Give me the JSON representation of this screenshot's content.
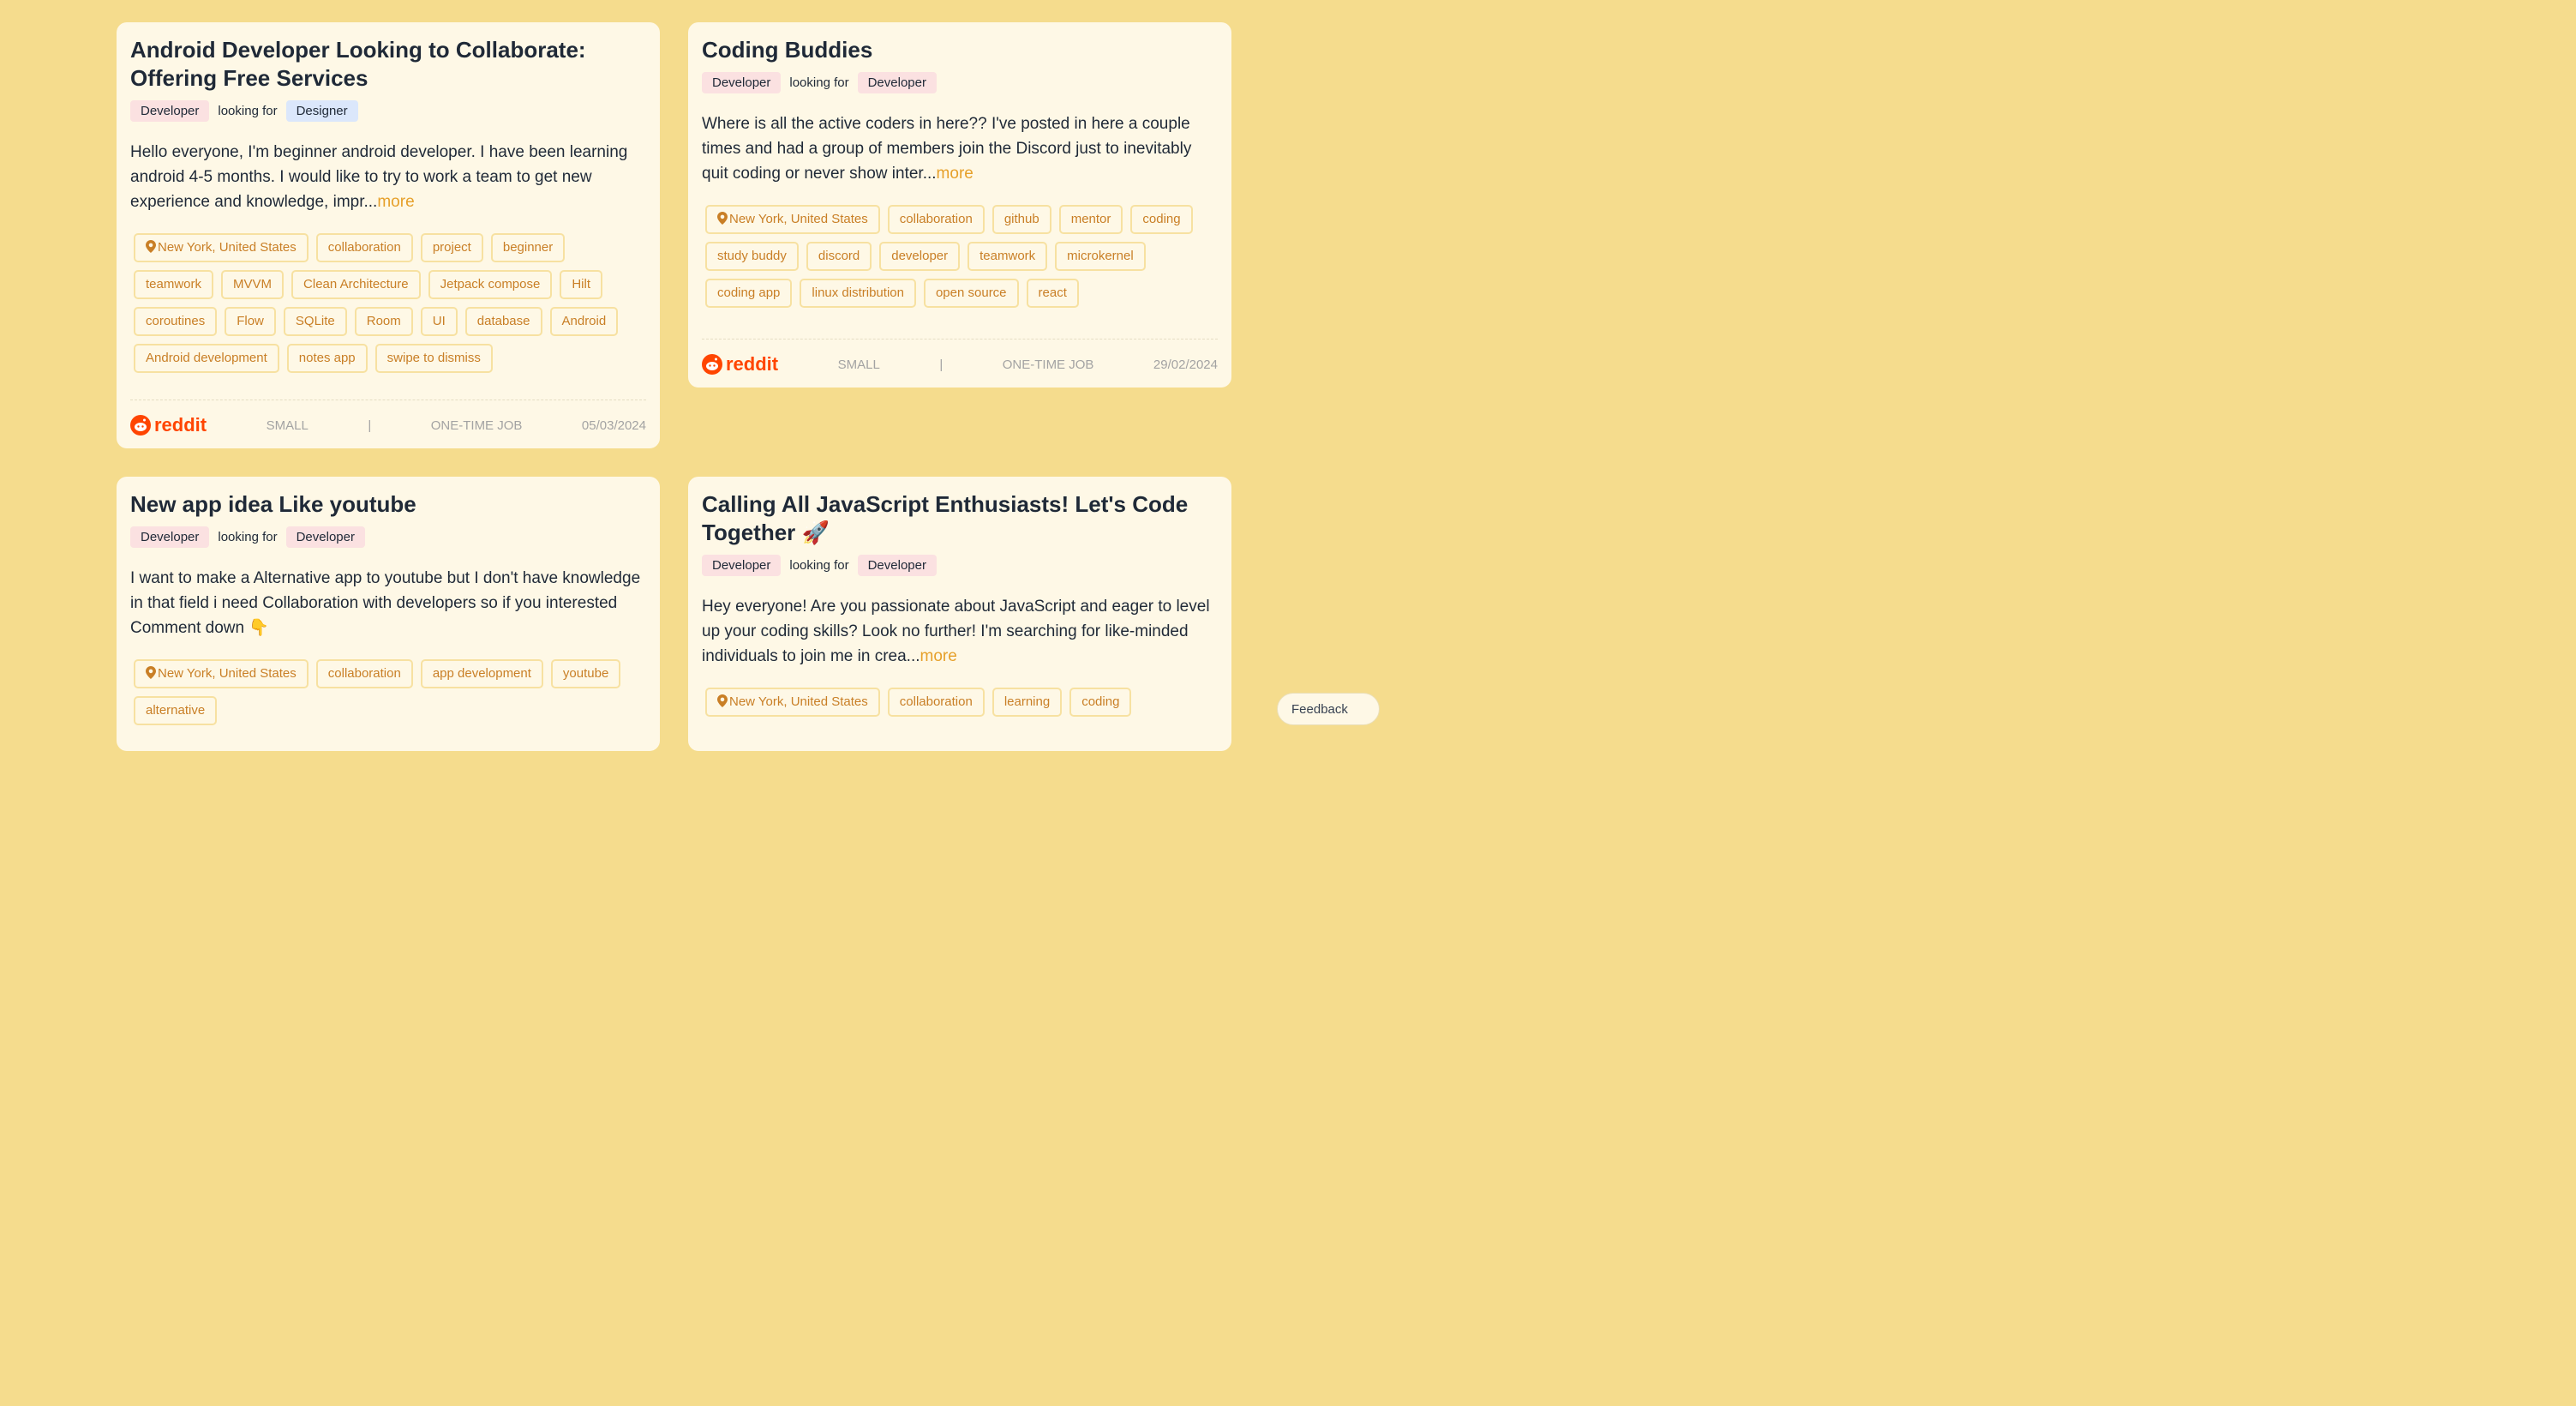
{
  "cards": [
    {
      "title": "Android Developer Looking to Collaborate: Offering Free Services",
      "role_from": "Developer",
      "looking_for": "looking for",
      "role_to": "Designer",
      "description": "Hello everyone, I'm beginner android developer. I have been learning android 4-5 months. I would like to try to work a team to get new experience and knowledge, impr...",
      "more": "more",
      "tags": [
        "New York, United States",
        "collaboration",
        "project",
        "beginner",
        "teamwork",
        "MVVM",
        "Clean Architecture",
        "Jetpack compose",
        "Hilt",
        "coroutines",
        "Flow",
        "SQLite",
        "Room",
        "UI",
        "database",
        "Android",
        "Android development",
        "notes app",
        "swipe to dismiss"
      ],
      "footer": {
        "source": "reddit",
        "size": "SMALL",
        "sep": "|",
        "type": "ONE-TIME JOB",
        "date": "05/03/2024"
      }
    },
    {
      "title": "Coding Buddies",
      "role_from": "Developer",
      "looking_for": "looking for",
      "role_to": "Developer",
      "description": "Where is all the active coders in here?? I've posted in here a couple times and had a group of members join the Discord just to inevitably quit coding or never show inter...",
      "more": "more",
      "tags": [
        "New York, United States",
        "collaboration",
        "github",
        "mentor",
        "coding",
        "study buddy",
        "discord",
        "developer",
        "teamwork",
        "microkernel",
        "coding app",
        "linux distribution",
        "open source",
        "react"
      ],
      "footer": {
        "source": "reddit",
        "size": "SMALL",
        "sep": "|",
        "type": "ONE-TIME JOB",
        "date": "29/02/2024"
      }
    },
    {
      "title": "New app idea Like youtube",
      "role_from": "Developer",
      "looking_for": "looking for",
      "role_to": "Developer",
      "description": "I want to make a Alternative app to youtube but I don't have knowledge in that field i need Collaboration with developers so if you interested Comment down 👇",
      "more": "",
      "tags": [
        "New York, United States",
        "collaboration",
        "app development",
        "youtube",
        "alternative"
      ]
    },
    {
      "title": "Calling All JavaScript Enthusiasts! Let's Code Together 🚀",
      "role_from": "Developer",
      "looking_for": "looking for",
      "role_to": "Developer",
      "description": "Hey everyone! Are you passionate about JavaScript and eager to level up your coding skills? Look no further! I'm searching for like-minded individuals to join me in crea...",
      "more": "more",
      "tags": [
        "New York, United States",
        "collaboration",
        "learning",
        "coding"
      ]
    }
  ],
  "feedback_label": "Feedback",
  "colors": {
    "background": "#f5dc8d",
    "card": "#fef8e6",
    "tag_text": "#c97f26",
    "more": "#e6a02a",
    "reddit": "#ff4500"
  }
}
